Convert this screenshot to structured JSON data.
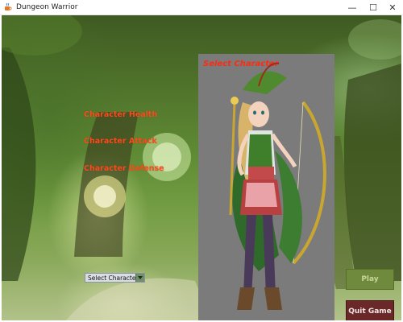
{
  "window": {
    "title": "Dungeon Warrior",
    "icon": "java-cup-icon",
    "controls": {
      "minimize": "—",
      "maximize": "☐",
      "close": "✕"
    }
  },
  "stats": {
    "health_label": "Character Health",
    "attack_label": "Character Attack",
    "defense_label": "Character Defense",
    "label_color": "#ff4a1c"
  },
  "character_select": {
    "selected": "Select Character",
    "arrow_icon": "chevron-down-icon"
  },
  "preview_panel": {
    "title": "Select Character",
    "title_color": "#ff2a10",
    "background": "#7b7b7b"
  },
  "buttons": {
    "play_label": "Play",
    "quit_label": "Quit Game",
    "play_color": "#6f8a3c",
    "quit_color": "#6b2828"
  }
}
